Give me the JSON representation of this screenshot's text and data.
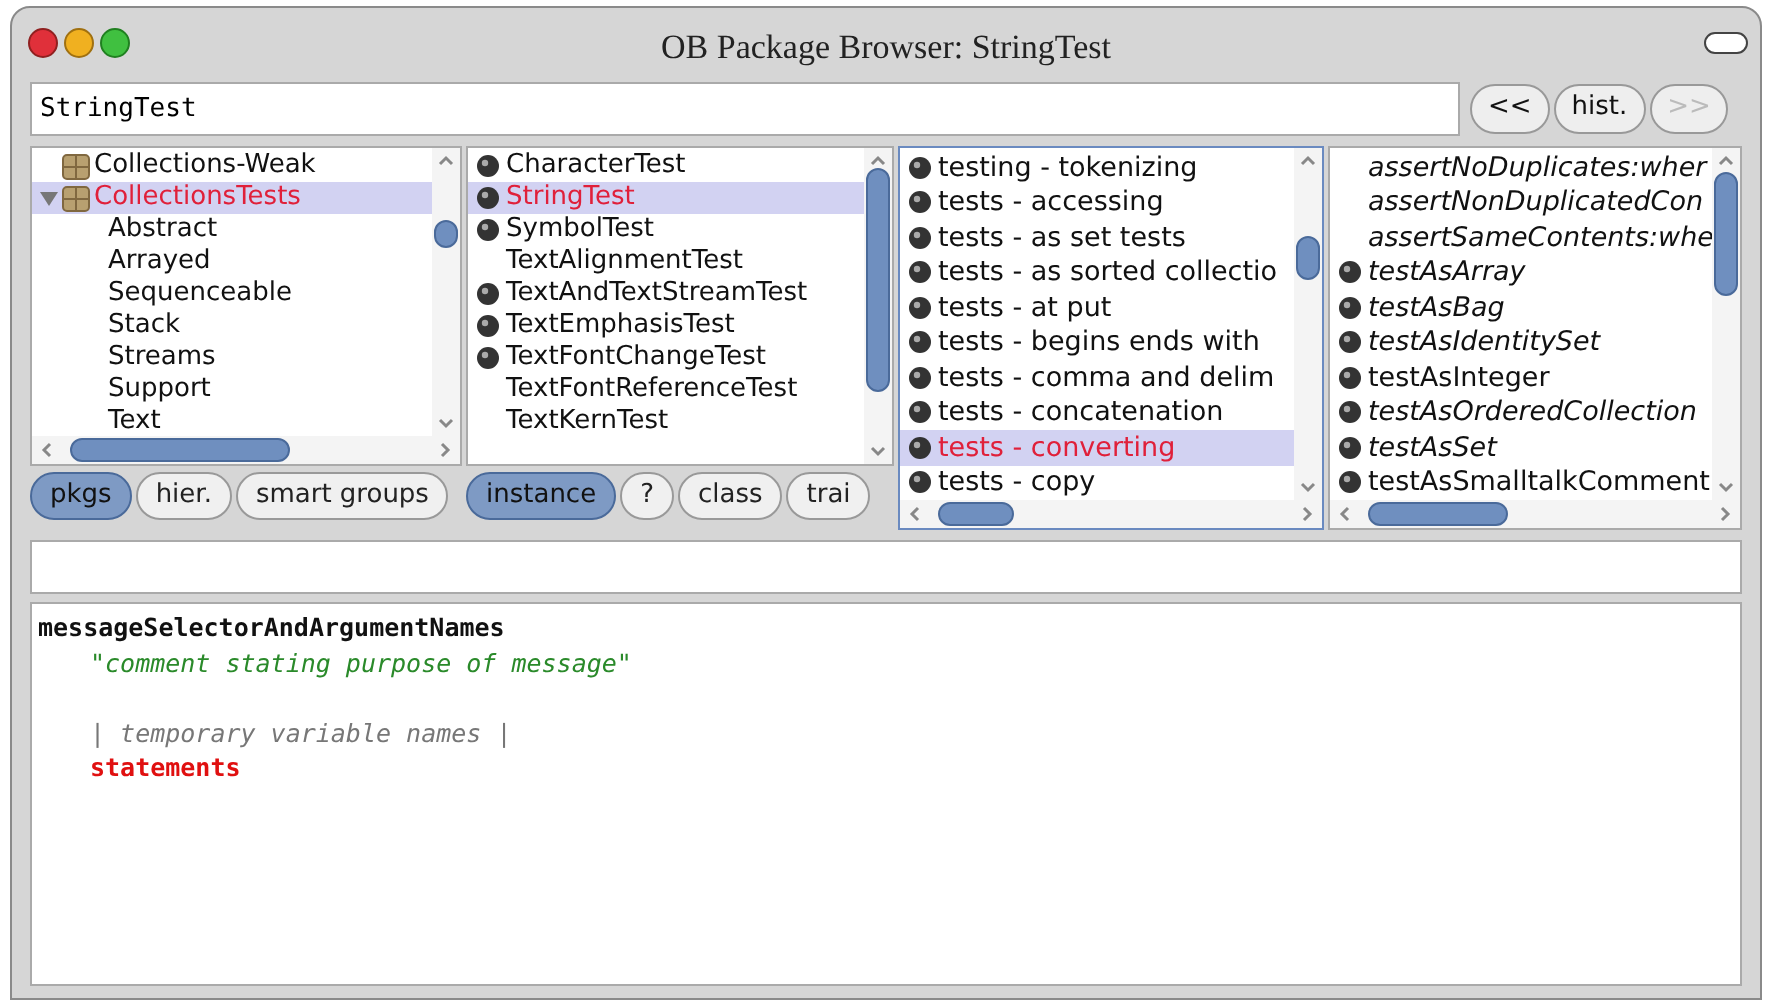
{
  "window": {
    "title": "OB Package Browser: StringTest"
  },
  "search": {
    "value": "StringTest"
  },
  "history_buttons": [
    {
      "label": "<<",
      "disabled": false
    },
    {
      "label": "hist.",
      "disabled": false
    },
    {
      "label": ">>",
      "disabled": true
    }
  ],
  "packages": [
    {
      "label": "Collections-Weak",
      "selected": false
    },
    {
      "label": "CollectionsTests",
      "selected": true,
      "expanded": true,
      "children": [
        {
          "label": "Abstract",
          "selected": false
        },
        {
          "label": "Arrayed",
          "selected": false
        },
        {
          "label": "Sequenceable",
          "selected": false
        },
        {
          "label": "Stack",
          "selected": false
        },
        {
          "label": "Streams",
          "selected": false
        },
        {
          "label": "Support",
          "selected": false
        },
        {
          "label": "Text",
          "selected": false
        }
      ]
    }
  ],
  "package_buttons": [
    {
      "label": "pkgs",
      "selected": true
    },
    {
      "label": "hier.",
      "selected": false
    },
    {
      "label": "smart groups",
      "selected": false
    }
  ],
  "classes": [
    {
      "label": "CharacterTest",
      "selected": false,
      "dot": true
    },
    {
      "label": "StringTest",
      "selected": true,
      "dot": true
    },
    {
      "label": "SymbolTest",
      "selected": false,
      "dot": true
    },
    {
      "label": "TextAlignmentTest",
      "selected": false,
      "dot": false
    },
    {
      "label": "TextAndTextStreamTest",
      "selected": false,
      "dot": true
    },
    {
      "label": "TextEmphasisTest",
      "selected": false,
      "dot": true
    },
    {
      "label": "TextFontChangeTest",
      "selected": false,
      "dot": true
    },
    {
      "label": "TextFontReferenceTest",
      "selected": false,
      "dot": false
    },
    {
      "label": "TextKernTest",
      "selected": false,
      "dot": false
    }
  ],
  "class_buttons": [
    {
      "label": "instance",
      "selected": true
    },
    {
      "label": "?",
      "selected": false
    },
    {
      "label": "class",
      "selected": false
    },
    {
      "label": "trai",
      "selected": false
    }
  ],
  "protocols": [
    {
      "label": "testing - tokenizing",
      "selected": false
    },
    {
      "label": "tests - accessing",
      "selected": false
    },
    {
      "label": "tests - as set tests",
      "selected": false
    },
    {
      "label": "tests - as sorted collectio",
      "selected": false
    },
    {
      "label": "tests - at put",
      "selected": false
    },
    {
      "label": "tests - begins ends with",
      "selected": false
    },
    {
      "label": "tests - comma and delim",
      "selected": false
    },
    {
      "label": "tests - concatenation",
      "selected": false
    },
    {
      "label": "tests - converting",
      "selected": true
    },
    {
      "label": "tests - copy",
      "selected": false
    }
  ],
  "methods": [
    {
      "label": "assertNoDuplicates:wher",
      "italic": true,
      "dot": false
    },
    {
      "label": "assertNonDuplicatedCon",
      "italic": true,
      "dot": false
    },
    {
      "label": "assertSameContents:whe",
      "italic": true,
      "dot": false
    },
    {
      "label": "testAsArray",
      "italic": true,
      "dot": true
    },
    {
      "label": "testAsBag",
      "italic": true,
      "dot": true
    },
    {
      "label": "testAsIdentitySet",
      "italic": true,
      "dot": true
    },
    {
      "label": "testAsInteger",
      "italic": false,
      "dot": true
    },
    {
      "label": "testAsOrderedCollection",
      "italic": true,
      "dot": true
    },
    {
      "label": "testAsSet",
      "italic": true,
      "dot": true
    },
    {
      "label": "testAsSmalltalkComment",
      "italic": false,
      "dot": true
    }
  ],
  "code": [
    {
      "kind": "selector",
      "text": "messageSelectorAndArgumentNames"
    },
    {
      "kind": "comment",
      "text": "\"comment stating purpose of message\""
    },
    {
      "kind": "blank"
    },
    {
      "kind": "temporaries",
      "text": "| temporary variable names |"
    },
    {
      "kind": "statements",
      "text": "statements"
    }
  ]
}
